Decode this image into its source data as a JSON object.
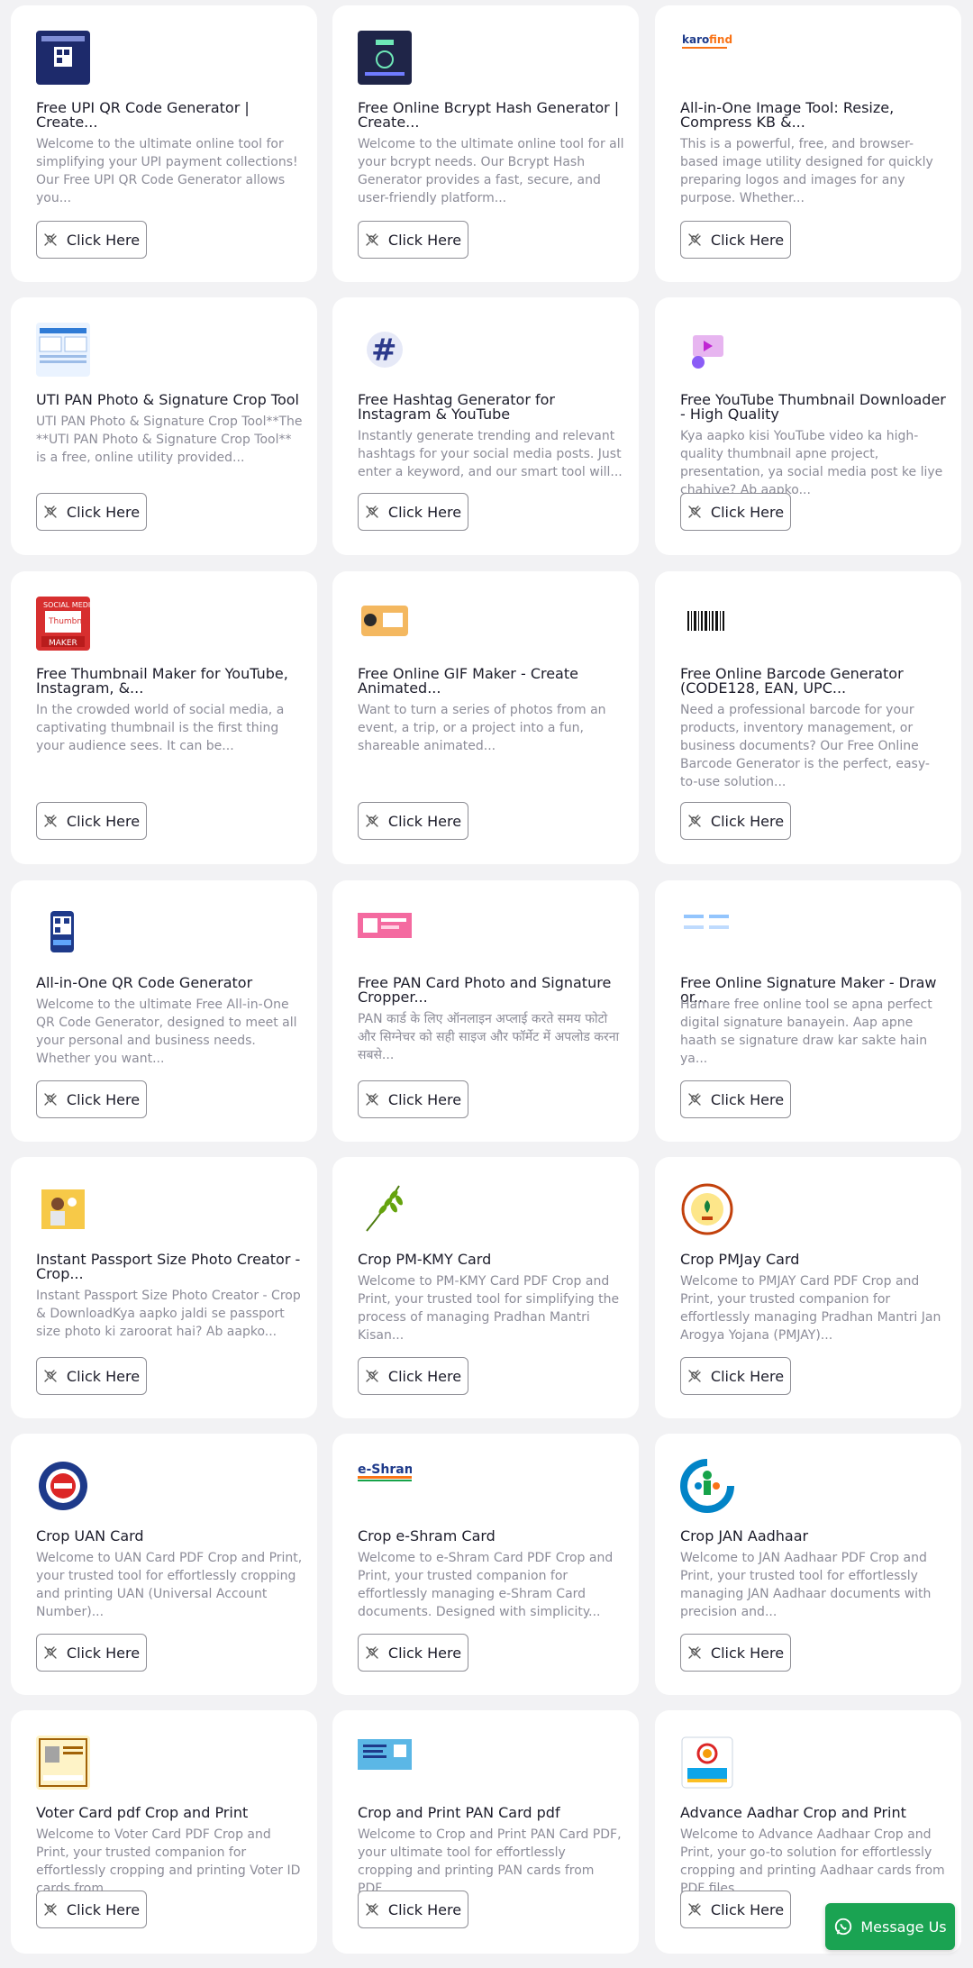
{
  "button_label": "Click Here",
  "message_label": "Message Us",
  "cards": [
    {
      "icon": "upi-qr-thumbnail",
      "title": "Free UPI QR Code Generator | Create...",
      "desc": "Welcome to the ultimate online tool for simplifying your UPI payment collections! Our Free UPI QR Code Generator allows you..."
    },
    {
      "icon": "bcrypt-thumbnail",
      "title": "Free Online Bcrypt Hash Generator | Create...",
      "desc": "Welcome to the ultimate online tool for all your bcrypt needs. Our Bcrypt Hash Generator provides a fast, secure, and user-friendly platform..."
    },
    {
      "icon": "karofind-logo",
      "title": "All-in-One Image Tool: Resize, Compress KB &...",
      "desc": "This is a powerful, free, and browser-based image utility designed for quickly preparing logos and images for any purpose. Whether..."
    },
    {
      "icon": "pan-form-thumbnail",
      "title": "UTI PAN Photo & Signature Crop Tool",
      "desc": "UTI PAN Photo & Signature Crop Tool**The **UTI PAN Photo & Signature Crop Tool** is a free, online utility provided..."
    },
    {
      "icon": "hashtag-icon",
      "title": "Free Hashtag Generator for Instagram & YouTube",
      "desc": "Instantly generate trending and relevant hashtags for your social media posts. Just enter a keyword, and our smart tool will..."
    },
    {
      "icon": "thumbnail-download-icon",
      "title": "Free YouTube Thumbnail Downloader - High Quality",
      "desc": "Kya aapko kisi YouTube video ka high-quality thumbnail apne project, presentation, ya social media post ke liye chahiye? Ab aapko..."
    },
    {
      "icon": "thumbnail-maker-thumbnail",
      "title": "Free Thumbnail Maker for YouTube, Instagram, &...",
      "desc": "In the crowded world of social media, a captivating thumbnail is the first thing your audience sees. It can be..."
    },
    {
      "icon": "gif-maker-thumbnail",
      "title": "Free Online GIF Maker - Create Animated...",
      "desc": "Want to turn a series of photos from an event, a trip, or a project into a fun, shareable animated..."
    },
    {
      "icon": "barcode-icon",
      "title": "Free Online Barcode Generator (CODE128, EAN, UPC...",
      "desc": "Need a professional barcode for your products, inventory management, or business documents? Our Free Online Barcode Generator is the perfect, easy-to-use solution..."
    },
    {
      "icon": "qr-phone-icon",
      "title": "All-in-One QR Code Generator",
      "desc": "Welcome to the ultimate Free All-in-One QR Code Generator, designed to meet all your personal and business needs. Whether you want..."
    },
    {
      "icon": "pan-card-thumbnail",
      "title": "Free PAN Card Photo and Signature Cropper...",
      "desc": "PAN कार्ड के लिए ऑनलाइन अप्लाई करते समय फोटो और सिग्नेचर को सही साइज और फॉर्मेट में अपलोड करना सबसे..."
    },
    {
      "icon": "signature-thumbnail",
      "title": "Free Online Signature Maker - Draw or...",
      "desc": "Hamare free online tool se apna perfect digital signature banayein. Aap apne haath se signature draw kar sakte hain ya..."
    },
    {
      "icon": "passport-photo-thumbnail",
      "title": "Instant Passport Size Photo Creator - Crop...",
      "desc": "Instant Passport Size Photo Creator - Crop & DownloadKya aapko jaldi se passport size photo ki zaroorat hai? Ab aapko..."
    },
    {
      "icon": "wheat-icon",
      "title": "Crop PM-KMY Card",
      "desc": "Welcome to PM-KMY Card PDF Crop and Print, your trusted tool for simplifying the process of managing Pradhan Mantri Kisan..."
    },
    {
      "icon": "pmjay-logo",
      "title": "Crop PMJay Card",
      "desc": "Welcome to PMJAY Card PDF Crop and Print, your trusted companion for effortlessly managing Pradhan Mantri Jan Arogya Yojana (PMJAY)..."
    },
    {
      "icon": "epfo-logo",
      "title": "Crop UAN Card",
      "desc": "Welcome to UAN Card PDF Crop and Print, your trusted tool for effortlessly cropping and printing UAN (Universal Account Number)..."
    },
    {
      "icon": "eshram-logo",
      "title": "Crop e-Shram Card",
      "desc": "Welcome to e-Shram Card PDF Crop and Print, your trusted companion for effortlessly managing e-Shram Card documents. Designed with simplicity..."
    },
    {
      "icon": "jan-aadhaar-logo",
      "title": "Crop JAN Aadhaar",
      "desc": "Welcome to JAN Aadhaar PDF Crop and Print, your trusted tool for effortlessly managing JAN Aadhaar documents with precision and..."
    },
    {
      "icon": "voter-card-thumbnail",
      "title": "Voter Card pdf Crop and Print",
      "desc": "Welcome to Voter Card PDF Crop and Print, your trusted companion for effortlessly cropping and printing Voter ID cards from..."
    },
    {
      "icon": "pan-card-print-thumbnail",
      "title": "Crop and Print PAN Card pdf",
      "desc": "Welcome to Crop and Print PAN Card PDF, your ultimate tool for effortlessly cropping and printing PAN cards from PDF..."
    },
    {
      "icon": "aadhaar-logo",
      "title": "Advance Aadhar Crop and Print",
      "desc": "Welcome to Advance Aadhaar Crop and Print, your go-to solution for effortlessly cropping and printing Aadhaar cards from PDF files...."
    }
  ]
}
